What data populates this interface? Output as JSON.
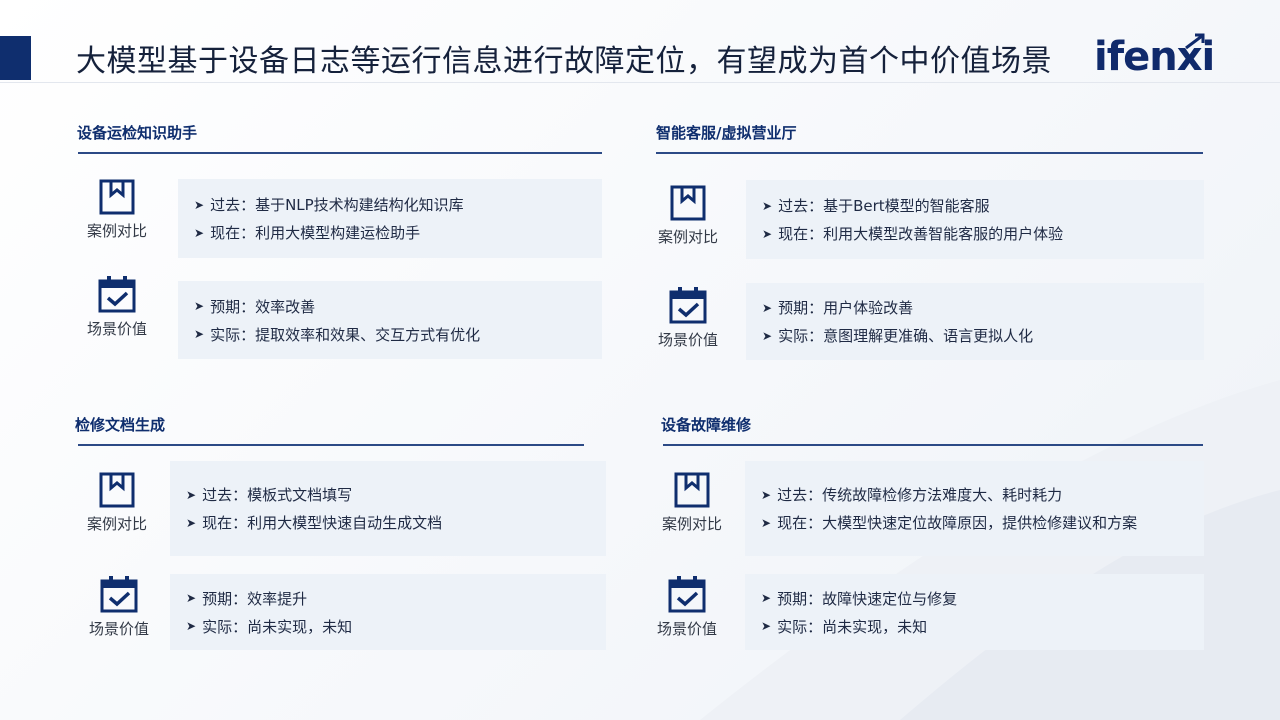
{
  "page_title": "大模型基于设备日志等运行信息进行故障定位，有望成为首个中价值场景",
  "logo_text": "ifenxi",
  "labels": {
    "compare": "案例对比",
    "value": "场景价值"
  },
  "icons": {
    "compare": "bookmark-icon",
    "value": "calendar-check-icon"
  },
  "colors": {
    "accent": "#0f2e6e",
    "box": "#edf2f8",
    "rule": "#2c4a86"
  },
  "sections": [
    {
      "title": "设备运检知识助手",
      "compare": [
        "过去：基于NLP技术构建结构化知识库",
        "现在：利用大模型构建运检助手"
      ],
      "value": [
        "预期：效率改善",
        "实际：提取效率和效果、交互方式有优化"
      ]
    },
    {
      "title": "智能客服/虚拟营业厅",
      "compare": [
        "过去：基于Bert模型的智能客服",
        "现在：利用大模型改善智能客服的用户体验"
      ],
      "value": [
        "预期：用户体验改善",
        "实际：意图理解更准确、语言更拟人化"
      ]
    },
    {
      "title": "检修文档生成",
      "compare": [
        "过去：模板式文档填写",
        "现在：利用大模型快速自动生成文档"
      ],
      "value": [
        "预期：效率提升",
        "实际：尚未实现，未知"
      ]
    },
    {
      "title": "设备故障维修",
      "compare": [
        "过去：传统故障检修方法难度大、耗时耗力",
        "现在：大模型快速定位故障原因，提供检修建议和方案"
      ],
      "value": [
        "预期：故障快速定位与修复",
        "实际：尚未实现，未知"
      ]
    }
  ]
}
